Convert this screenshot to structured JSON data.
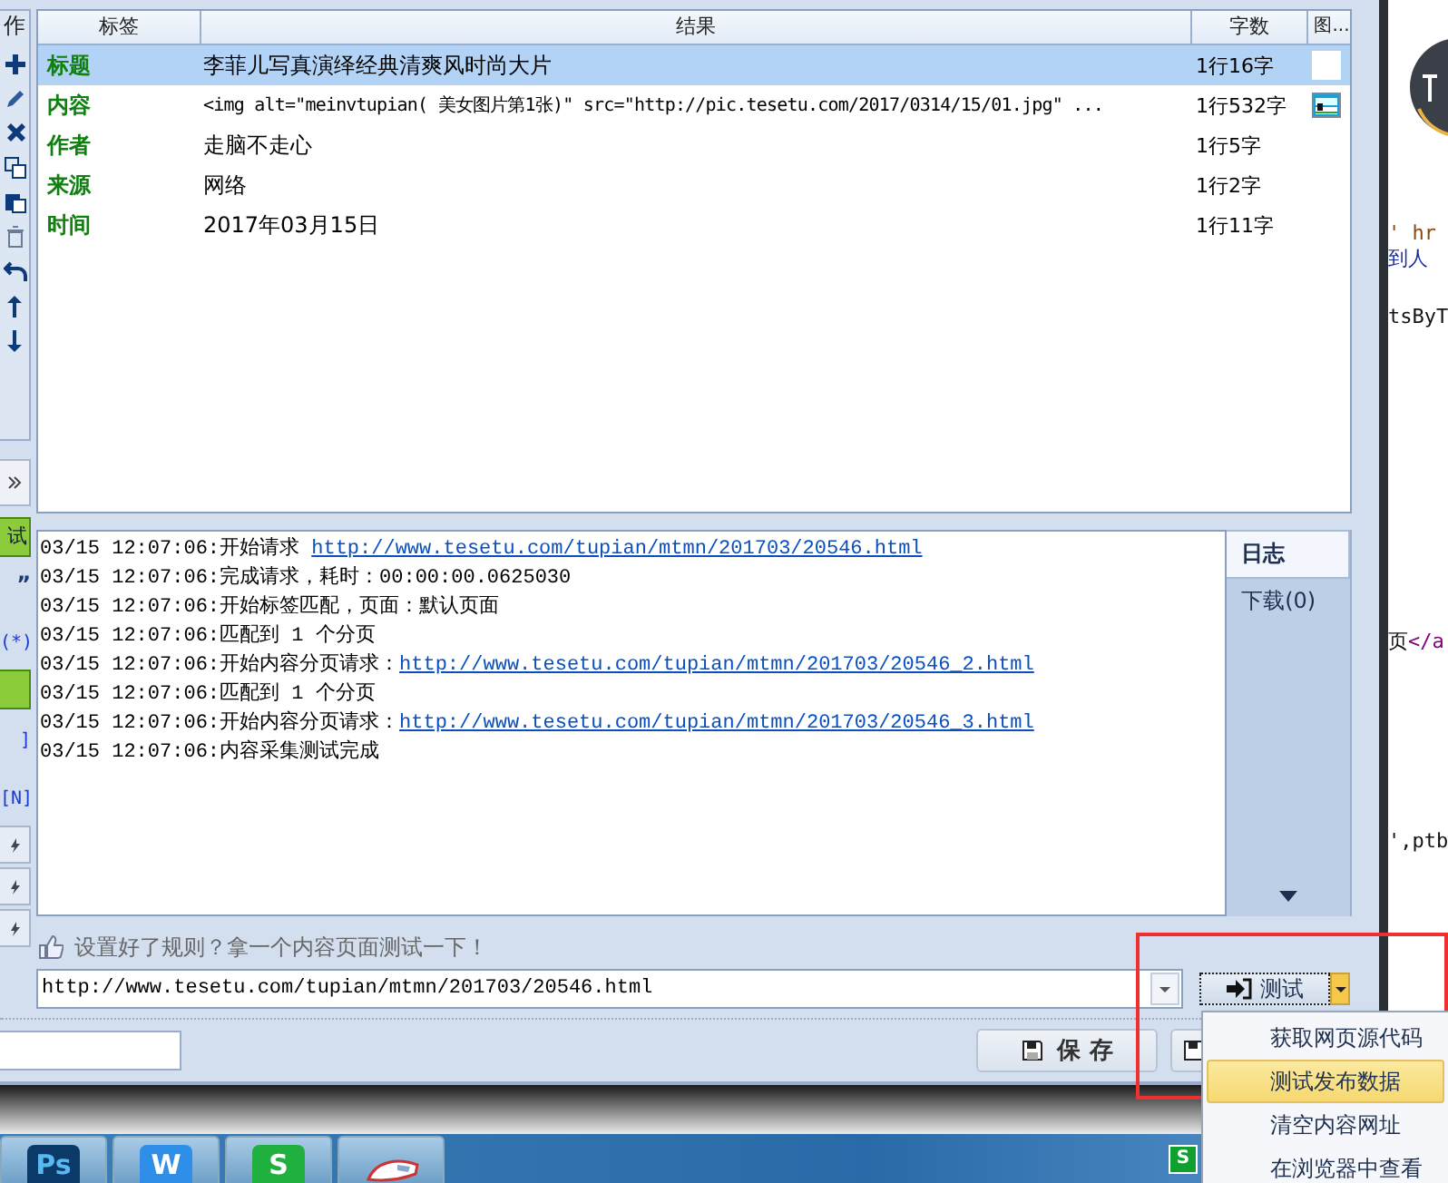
{
  "toolstrip": {
    "title": "作"
  },
  "left_strip": [
    {
      "kind": "collapse"
    },
    {
      "kind": "green",
      "label": "试"
    },
    {
      "kind": "text",
      "label": "”"
    },
    {
      "kind": "link",
      "label": "(*)"
    },
    {
      "kind": "green"
    },
    {
      "kind": "link",
      "label": "]"
    },
    {
      "kind": "link",
      "label": "[N]"
    },
    {
      "kind": "small"
    },
    {
      "kind": "small"
    },
    {
      "kind": "small"
    }
  ],
  "table": {
    "columns": [
      "标签",
      "结果",
      "字数",
      "图..."
    ],
    "rows": [
      {
        "label": "标题",
        "result": "李菲儿写真演绎经典清爽风时尚大片",
        "kind": "text",
        "count": "1行16字",
        "image": false,
        "selected": true
      },
      {
        "label": "内容",
        "result": "<img alt=\"meinvtupian( 美女图片第1张)\" src=\"http://pic.tesetu.com/2017/0314/15/01.jpg\" ...",
        "kind": "code",
        "count": "1行532字",
        "image": true,
        "selected": false
      },
      {
        "label": "作者",
        "result": "走脑不走心",
        "kind": "text",
        "count": "1行5字",
        "image": false,
        "selected": false
      },
      {
        "label": "来源",
        "result": "网络",
        "kind": "text",
        "count": "1行2字",
        "image": false,
        "selected": false
      },
      {
        "label": "时间",
        "result": "2017年03月15日",
        "kind": "text",
        "count": "1行11字",
        "image": false,
        "selected": false
      }
    ]
  },
  "log": [
    {
      "text": "03/15 12:07:06:开始请求 ",
      "link": "http://www.tesetu.com/tupian/mtmn/201703/20546.html"
    },
    {
      "text": "03/15 12:07:06:完成请求，耗时：00:00:00.0625030"
    },
    {
      "text": "03/15 12:07:06:开始标签匹配，页面：默认页面"
    },
    {
      "text": "03/15 12:07:06:匹配到 1 个分页"
    },
    {
      "text": "03/15 12:07:06:开始内容分页请求：",
      "link": "http://www.tesetu.com/tupian/mtmn/201703/20546_2.html"
    },
    {
      "text": "03/15 12:07:06:匹配到 1 个分页"
    },
    {
      "text": "03/15 12:07:06:开始内容分页请求：",
      "link": "http://www.tesetu.com/tupian/mtmn/201703/20546_3.html"
    },
    {
      "text": "03/15 12:07:06:内容采集测试完成"
    }
  ],
  "log_tabs": [
    {
      "label": "日志",
      "selected": true
    },
    {
      "label": "下载(0)",
      "selected": false
    }
  ],
  "hint": "设置好了规则？拿一个内容页面测试一下！",
  "url_field": {
    "value": "http://www.tesetu.com/tupian/mtmn/201703/20546.html"
  },
  "test_button": {
    "label": "测试",
    "menu_open": true
  },
  "save_button": {
    "label": "保 存"
  },
  "test_menu": [
    {
      "label": "获取网页源代码",
      "selected": false
    },
    {
      "label": "测试发布数据",
      "selected": true
    },
    {
      "label": "清空内容网址",
      "selected": false
    },
    {
      "label": "在浏览器中查看",
      "selected": false
    }
  ],
  "highlight_frame": true,
  "editor_fragments": [
    {
      "kind": "attr",
      "text": "' hr"
    },
    {
      "kind": "text",
      "text": "到人"
    },
    {
      "kind": "plain",
      "text": "tsByT"
    },
    {
      "kind": "plain",
      "text": "页"
    },
    {
      "kind": "tag",
      "text": "</a"
    },
    {
      "kind": "plain",
      "text": "',ptb"
    }
  ],
  "taskbar": [
    {
      "kind": "ps",
      "label": "Ps"
    },
    {
      "kind": "writer",
      "label": "W"
    },
    {
      "kind": "sheet",
      "label": "S"
    },
    {
      "kind": "train"
    }
  ],
  "tray": [
    {
      "label": "S"
    }
  ]
}
